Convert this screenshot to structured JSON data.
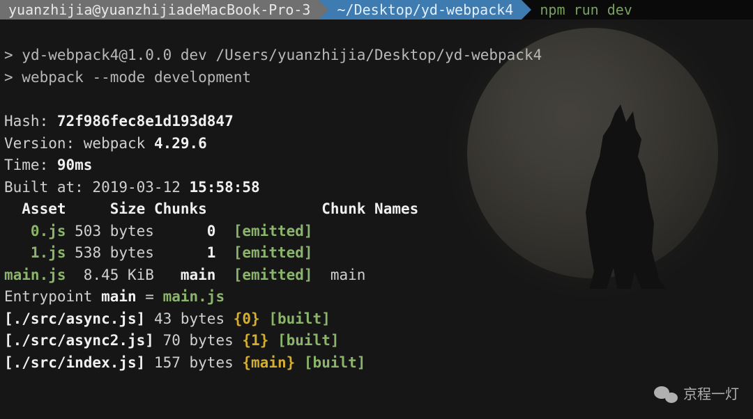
{
  "prompt": {
    "user": "yuanzhijia@yuanzhijiadeMacBook-Pro-3",
    "path": "~/Desktop/yd-webpack4",
    "command": "npm run dev"
  },
  "output": {
    "line1_prefix": "> ",
    "line1": "yd-webpack4@1.0.0 dev /Users/yuanzhijia/Desktop/yd-webpack4",
    "line2_prefix": "> ",
    "line2": "webpack --mode development",
    "hash_label": "Hash: ",
    "hash_value": "72f986fec8e1d193d847",
    "version_label": "Version: webpack ",
    "version_value": "4.29.6",
    "time_label": "Time: ",
    "time_value": "90ms",
    "built_label": "Built at: 2019-03-12 ",
    "built_value": "15:58:58",
    "table": {
      "headers": {
        "asset": "  Asset",
        "size": "     Size",
        "chunks": " Chunks",
        "gap": "            ",
        "names": " Chunk Names"
      },
      "rows": [
        {
          "asset": "   0.js",
          "size": " 503 bytes",
          "chunks": "      0",
          "status": "  [emitted]",
          "names": "  "
        },
        {
          "asset": "   1.js",
          "size": " 538 bytes",
          "chunks": "      1",
          "status": "  [emitted]",
          "names": "  "
        },
        {
          "asset": "main.js",
          "size": "  8.45 KiB",
          "chunks": "   main",
          "status": "  [emitted]",
          "names": "  main"
        }
      ]
    },
    "entry_prefix": "Entrypoint ",
    "entry_name": "main",
    "entry_eq": " = ",
    "entry_file": "main.js",
    "modules": [
      {
        "path": "[./src/async.js]",
        "bytes": " 43 bytes ",
        "chunk_open": "{",
        "chunk": "0",
        "chunk_close": "}",
        "status": " [built]"
      },
      {
        "path": "[./src/async2.js]",
        "bytes": " 70 bytes ",
        "chunk_open": "{",
        "chunk": "1",
        "chunk_close": "}",
        "status": " [built]"
      },
      {
        "path": "[./src/index.js]",
        "bytes": " 157 bytes ",
        "chunk_open": "{",
        "chunk": "main",
        "chunk_close": "}",
        "status": " [built]"
      }
    ]
  },
  "watermark": "京程一灯"
}
